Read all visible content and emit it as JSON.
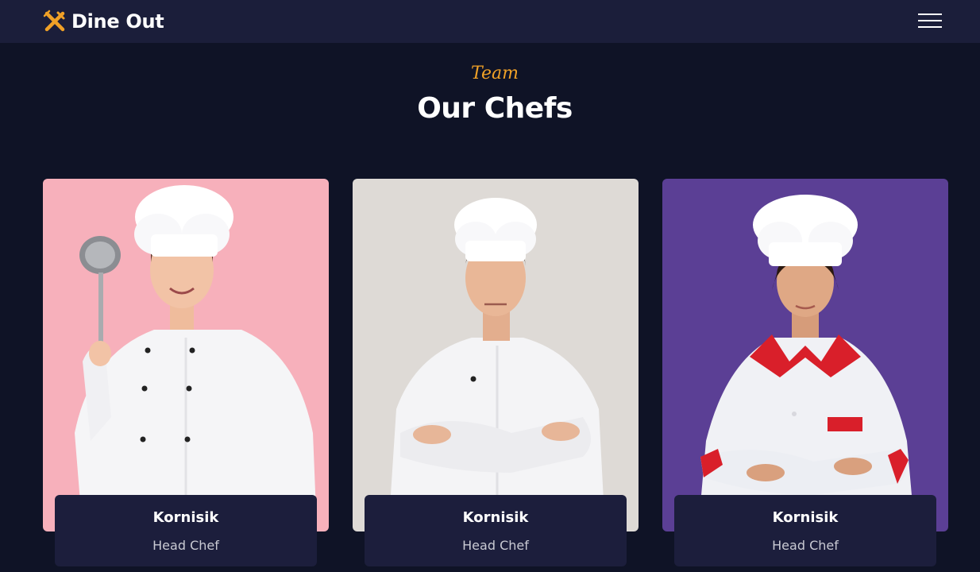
{
  "header": {
    "brand_name": "Dine Out",
    "brand_icon": "fork-knife-icon",
    "menu_icon": "hamburger-menu-icon"
  },
  "section": {
    "eyebrow": "Team",
    "title": "Our Chefs"
  },
  "chefs": [
    {
      "name": "Kornisik",
      "role": "Head Chef",
      "photo_background": "#f7b0bb"
    },
    {
      "name": "Kornisik",
      "role": "Head Chef",
      "photo_background": "#dedad6"
    },
    {
      "name": "Kornisik",
      "role": "Head Chef",
      "photo_background": "#5b3f95"
    }
  ],
  "colors": {
    "page_background": "#0f1326",
    "navbar_background": "#1b1e3a",
    "card_info_background": "#1c1e3c",
    "accent": "#f0a127"
  }
}
